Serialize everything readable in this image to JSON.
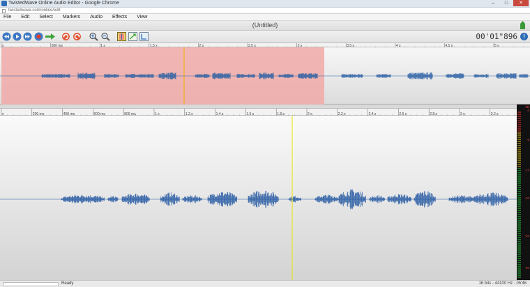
{
  "window": {
    "title": "TwistedWave Online Audio Editor - Google Chrome",
    "url": "twistedwave.com/online/edit"
  },
  "menu": {
    "items": [
      "File",
      "Edit",
      "Select",
      "Markers",
      "Audio",
      "Effects",
      "View"
    ]
  },
  "document": {
    "title": "(Untitled)"
  },
  "toolbar": {
    "time": "00'01\"896",
    "buttons": [
      {
        "name": "rewind-button",
        "icon": "rewind-icon"
      },
      {
        "name": "play-button",
        "icon": "play-icon"
      },
      {
        "name": "fast-forward-button",
        "icon": "fast-forward-icon"
      },
      {
        "name": "record-button",
        "icon": "record-icon"
      },
      {
        "name": "loop-button",
        "icon": "arrow-right-icon"
      },
      {
        "name": "undo-button",
        "icon": "undo-icon"
      },
      {
        "name": "redo-button",
        "icon": "redo-icon"
      },
      {
        "name": "zoom-in-button",
        "icon": "zoom-in-icon"
      },
      {
        "name": "zoom-out-button",
        "icon": "zoom-out-icon"
      },
      {
        "name": "zoom-selection-button",
        "icon": "zoom-selection-icon"
      },
      {
        "name": "zoom-fit-button",
        "icon": "zoom-fit-icon"
      },
      {
        "name": "zoom-full-button",
        "icon": "zoom-full-icon"
      }
    ]
  },
  "overview": {
    "ticks": [
      "s",
      "500 ms",
      "1 s",
      "1.5 s",
      "2 s",
      "2.5 s",
      "3 s",
      "3.5 s",
      "4 s",
      "4.5 s",
      "5 s"
    ],
    "selection_color": "#f0aaa7",
    "playhead_color": "#f0b000",
    "wave_color": "#2a5fa4"
  },
  "main": {
    "ticks": [
      "s",
      "200 ms",
      "400 ms",
      "600 ms",
      "800 ms",
      "1 s",
      "1.2 s",
      "1.4 s",
      "1.6 s",
      "1.8 s",
      "2 s",
      "2.2 s",
      "2.4 s",
      "2.6 s",
      "2.8 s",
      "3 s",
      "3.2 s"
    ],
    "cursor_color": "#f0e000",
    "wave_color": "#1f55a0"
  },
  "meter": {
    "labels": [
      "dB",
      "0",
      "-6",
      "-12",
      "-20",
      "-40",
      "-60"
    ]
  },
  "status": {
    "text": "Ready",
    "format": "16 bits - 44100 Hz - 05'46"
  }
}
